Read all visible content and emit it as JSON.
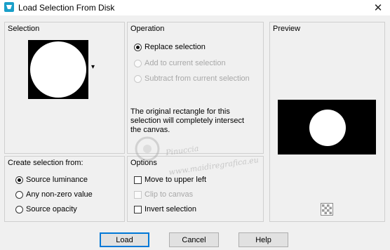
{
  "window": {
    "title": "Load Selection From Disk",
    "close_glyph": "✕",
    "icon": "app-icon"
  },
  "selection": {
    "title": "Selection",
    "dropdown_glyph": "▾"
  },
  "operation": {
    "title": "Operation",
    "options": [
      {
        "label": "Replace selection",
        "checked": true,
        "enabled": true
      },
      {
        "label": "Add to current selection",
        "checked": false,
        "enabled": false
      },
      {
        "label": "Subtract from current selection",
        "checked": false,
        "enabled": false
      }
    ],
    "note_line1": "The original rectangle for this",
    "note_line2": "selection will completely intersect",
    "note_line3": "the canvas."
  },
  "preview": {
    "title": "Preview",
    "icon": "transparency-checker-icon"
  },
  "create_from": {
    "title": "Create selection from:",
    "options": [
      {
        "label": "Source luminance",
        "checked": true
      },
      {
        "label": "Any non-zero value",
        "checked": false
      },
      {
        "label": "Source opacity",
        "checked": false
      }
    ]
  },
  "options": {
    "title": "Options",
    "items": [
      {
        "label": "Move to upper left",
        "checked": false,
        "enabled": true
      },
      {
        "label": "Clip to canvas",
        "checked": false,
        "enabled": false
      },
      {
        "label": "Invert selection",
        "checked": false,
        "enabled": true
      }
    ]
  },
  "watermark": {
    "name": "Pinuccia",
    "site": "www.maidiregrafica.eu"
  },
  "buttons": {
    "load": "Load",
    "cancel": "Cancel",
    "help": "Help"
  },
  "colors": {
    "accent": "#0078d7",
    "icon_bg": "#1a9fc9"
  }
}
